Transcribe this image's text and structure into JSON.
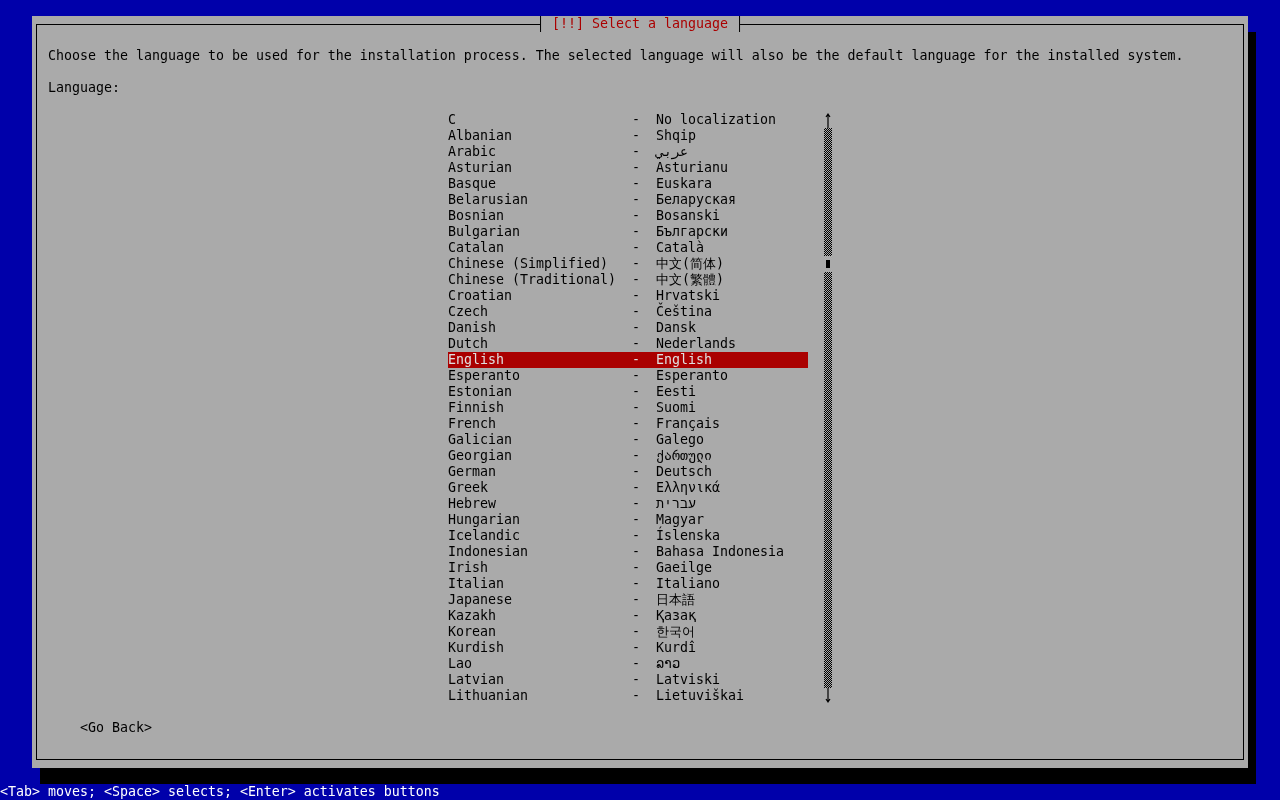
{
  "dialog": {
    "title": "[!!] Select a language",
    "description": "Choose the language to be used for the installation process. The selected language will also be the default language for the installed system.",
    "list_label": "Language:",
    "languages": [
      {
        "name": "C",
        "separator": "-",
        "native_name": "No localization",
        "selected": false
      },
      {
        "name": "Albanian",
        "separator": "-",
        "native_name": "Shqip",
        "selected": false
      },
      {
        "name": "Arabic",
        "separator": "-",
        "native_name": "عربي",
        "selected": false
      },
      {
        "name": "Asturian",
        "separator": "-",
        "native_name": "Asturianu",
        "selected": false
      },
      {
        "name": "Basque",
        "separator": "-",
        "native_name": "Euskara",
        "selected": false
      },
      {
        "name": "Belarusian",
        "separator": "-",
        "native_name": "Беларуская",
        "selected": false
      },
      {
        "name": "Bosnian",
        "separator": "-",
        "native_name": "Bosanski",
        "selected": false
      },
      {
        "name": "Bulgarian",
        "separator": "-",
        "native_name": "Български",
        "selected": false
      },
      {
        "name": "Catalan",
        "separator": "-",
        "native_name": "Català",
        "selected": false
      },
      {
        "name": "Chinese (Simplified)",
        "separator": "-",
        "native_name": "中文(简体)",
        "selected": false
      },
      {
        "name": "Chinese (Traditional)",
        "separator": "-",
        "native_name": "中文(繁體)",
        "selected": false
      },
      {
        "name": "Croatian",
        "separator": "-",
        "native_name": "Hrvatski",
        "selected": false
      },
      {
        "name": "Czech",
        "separator": "-",
        "native_name": "Čeština",
        "selected": false
      },
      {
        "name": "Danish",
        "separator": "-",
        "native_name": "Dansk",
        "selected": false
      },
      {
        "name": "Dutch",
        "separator": "-",
        "native_name": "Nederlands",
        "selected": false
      },
      {
        "name": "English",
        "separator": "-",
        "native_name": "English",
        "selected": true
      },
      {
        "name": "Esperanto",
        "separator": "-",
        "native_name": "Esperanto",
        "selected": false
      },
      {
        "name": "Estonian",
        "separator": "-",
        "native_name": "Eesti",
        "selected": false
      },
      {
        "name": "Finnish",
        "separator": "-",
        "native_name": "Suomi",
        "selected": false
      },
      {
        "name": "French",
        "separator": "-",
        "native_name": "Français",
        "selected": false
      },
      {
        "name": "Galician",
        "separator": "-",
        "native_name": "Galego",
        "selected": false
      },
      {
        "name": "Georgian",
        "separator": "-",
        "native_name": "ქართული",
        "selected": false
      },
      {
        "name": "German",
        "separator": "-",
        "native_name": "Deutsch",
        "selected": false
      },
      {
        "name": "Greek",
        "separator": "-",
        "native_name": "Ελληνικά",
        "selected": false
      },
      {
        "name": "Hebrew",
        "separator": "-",
        "native_name": "עברית",
        "selected": false
      },
      {
        "name": "Hungarian",
        "separator": "-",
        "native_name": "Magyar",
        "selected": false
      },
      {
        "name": "Icelandic",
        "separator": "-",
        "native_name": "Íslenska",
        "selected": false
      },
      {
        "name": "Indonesian",
        "separator": "-",
        "native_name": "Bahasa Indonesia",
        "selected": false
      },
      {
        "name": "Irish",
        "separator": "-",
        "native_name": "Gaeilge",
        "selected": false
      },
      {
        "name": "Italian",
        "separator": "-",
        "native_name": "Italiano",
        "selected": false
      },
      {
        "name": "Japanese",
        "separator": "-",
        "native_name": "日本語",
        "selected": false
      },
      {
        "name": "Kazakh",
        "separator": "-",
        "native_name": "Қазақ",
        "selected": false
      },
      {
        "name": "Korean",
        "separator": "-",
        "native_name": "한국어",
        "selected": false
      },
      {
        "name": "Kurdish",
        "separator": "-",
        "native_name": "Kurdî",
        "selected": false
      },
      {
        "name": "Lao",
        "separator": "-",
        "native_name": "ລາວ",
        "selected": false
      },
      {
        "name": "Latvian",
        "separator": "-",
        "native_name": "Latviski",
        "selected": false
      },
      {
        "name": "Lithuanian",
        "separator": "-",
        "native_name": "Lietuviškai",
        "selected": false
      }
    ],
    "buttons": [
      {
        "label": "<Go Back>"
      }
    ]
  },
  "status_bar": "<Tab> moves; <Space> selects; <Enter> activates buttons"
}
